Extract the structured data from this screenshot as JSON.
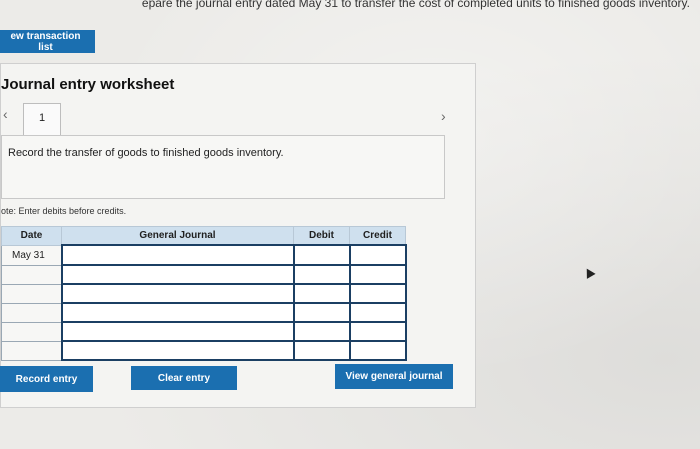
{
  "instruction": "epare the journal entry dated May 31 to transfer the cost of completed units to finished goods inventory.",
  "buttons": {
    "view_transaction_list": "ew transaction list",
    "record_entry": "Record entry",
    "clear_entry": "Clear entry",
    "view_general_journal": "View general journal"
  },
  "worksheet": {
    "title": "Journal entry worksheet",
    "tab_number": "1",
    "prev_icon": "‹",
    "next_icon": "›",
    "task": "Record the transfer of goods to finished goods inventory.",
    "note": "ote: Enter debits before credits."
  },
  "journal_table": {
    "headers": [
      "Date",
      "General Journal",
      "Debit",
      "Credit"
    ],
    "rows": [
      {
        "date": "May 31"
      },
      {
        "date": ""
      },
      {
        "date": ""
      },
      {
        "date": ""
      },
      {
        "date": ""
      },
      {
        "date": ""
      }
    ]
  },
  "colors": {
    "button_blue": "#1b6fb0",
    "header_blue": "#cfe0ee",
    "input_border": "#1b3f63"
  },
  "icons": [
    "chevron-left-icon",
    "chevron-right-icon",
    "mouse-cursor-icon"
  ]
}
